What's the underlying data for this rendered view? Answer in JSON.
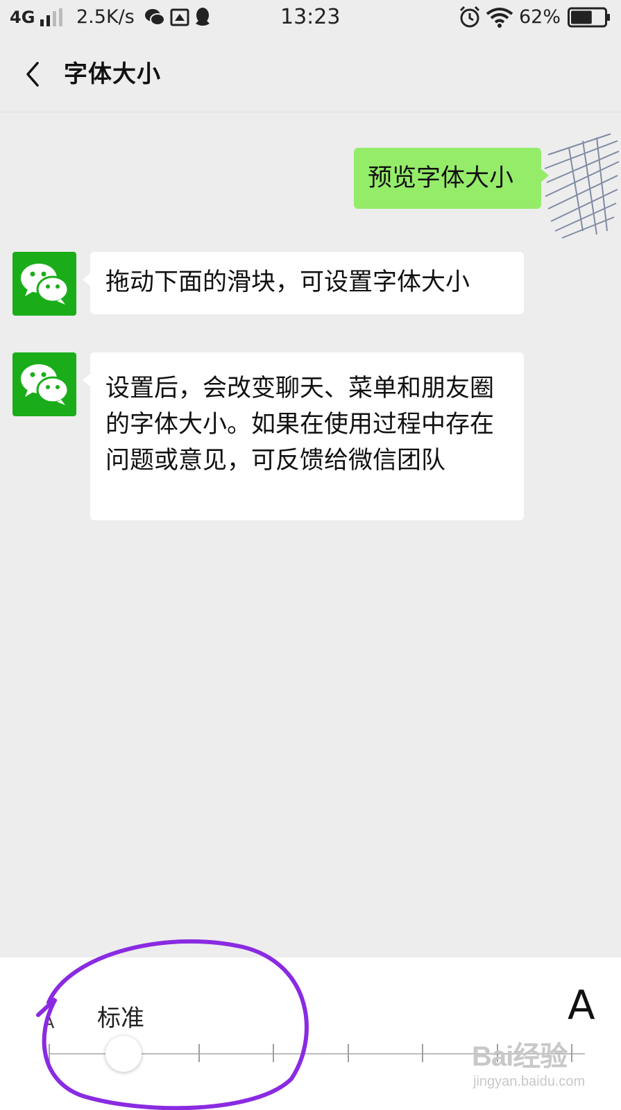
{
  "status_bar": {
    "network_type": "4G",
    "net_speed": "2.5K/s",
    "time": "13:23",
    "battery_percent": "62%",
    "battery_level": 0.62
  },
  "header": {
    "title": "字体大小"
  },
  "chat": {
    "sent_message": "预览字体大小",
    "received_messages": [
      {
        "text": "拖动下面的滑块，可设置字体大小"
      },
      {
        "text": "设置后，会改变聊天、菜单和朋友圈的字体大小。如果在使用过程中存在问题或意见，可反馈给微信团队"
      }
    ]
  },
  "font_size_panel": {
    "small_label": "A",
    "selected_label": "标准",
    "large_label": "A",
    "tick_count": 8,
    "selected_index": 1
  },
  "watermark": {
    "logo_text": "Bai经验",
    "site": "jingyan.baidu.com"
  },
  "colors": {
    "sent_bubble": "#95ec69",
    "wechat_green": "#1aad19",
    "annotation": "#8a2be2"
  }
}
